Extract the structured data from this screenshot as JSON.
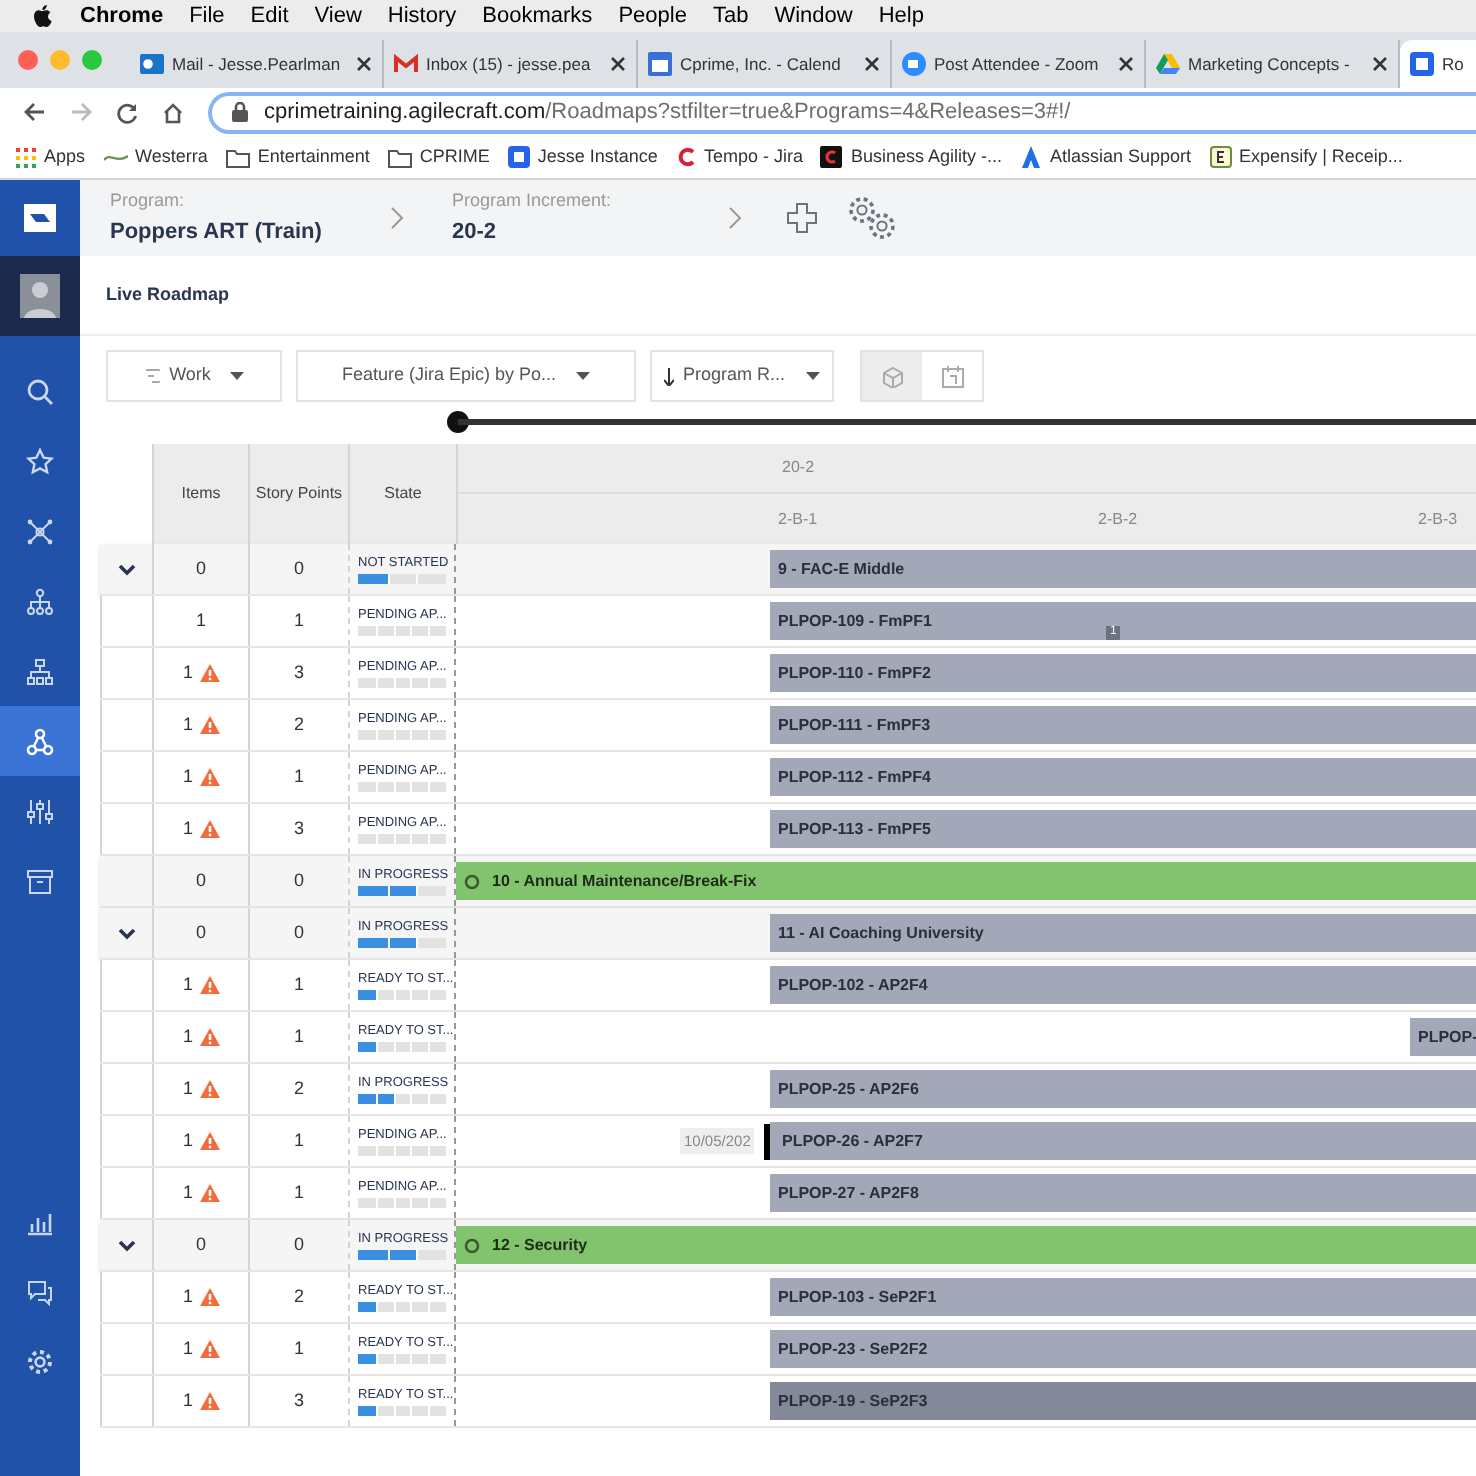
{
  "menu_bar": {
    "app": "Chrome",
    "items": [
      "File",
      "Edit",
      "View",
      "History",
      "Bookmarks",
      "People",
      "Tab",
      "Window",
      "Help"
    ]
  },
  "tabs": [
    {
      "label": "Mail - Jesse.Pearlman",
      "kind": "mail",
      "selected": false
    },
    {
      "label": "Inbox (15) - jesse.pea",
      "kind": "gmail",
      "selected": false
    },
    {
      "label": "Cprime, Inc. - Calend",
      "kind": "calendar",
      "selected": false
    },
    {
      "label": "Post Attendee - Zoom",
      "kind": "video",
      "selected": false
    },
    {
      "label": "Marketing Concepts -",
      "kind": "drive",
      "selected": false
    },
    {
      "label": "Ro",
      "kind": "app",
      "selected": true
    }
  ],
  "address_bar": {
    "domain": "cprimetraining.agilecraft.com",
    "path": "/Roadmaps?stfilter=true&Programs=4&Releases=3#!/"
  },
  "bookmarks": [
    {
      "label": "Apps",
      "kind": "apps"
    },
    {
      "label": "Westerra",
      "kind": "wave"
    },
    {
      "label": "Entertainment",
      "kind": "folder"
    },
    {
      "label": "CPRIME",
      "kind": "folder"
    },
    {
      "label": "Jesse Instance",
      "kind": "app"
    },
    {
      "label": "Tempo - Jira",
      "kind": "letter-c"
    },
    {
      "label": "Business Agility -...",
      "kind": "dark-c"
    },
    {
      "label": "Atlassian Support",
      "kind": "atlassian"
    },
    {
      "label": "Expensify | Receip...",
      "kind": "e-badge"
    }
  ],
  "sidebar": {
    "items": [
      {
        "kind": "search",
        "selected": false
      },
      {
        "kind": "star",
        "selected": false
      },
      {
        "kind": "network",
        "selected": false
      },
      {
        "kind": "hierarchy",
        "selected": false
      },
      {
        "kind": "sitemap",
        "selected": false
      },
      {
        "kind": "share",
        "selected": true
      },
      {
        "kind": "sliders",
        "selected": false
      },
      {
        "kind": "archive",
        "selected": false
      }
    ],
    "bottom_items": [
      {
        "kind": "chart",
        "selected": false
      },
      {
        "kind": "chat",
        "selected": false
      },
      {
        "kind": "settings",
        "selected": false
      }
    ]
  },
  "header": {
    "program_label": "Program:",
    "program": "Poppers ART (Train)",
    "increment_label": "Program Increment:",
    "increment": "20-2"
  },
  "page_title": "Live Roadmap",
  "toolbar": {
    "work": "Work",
    "grouping": "Feature (Jira Epic) by Po...",
    "sort": "Program R...",
    "views": [
      {
        "kind": "cube",
        "selected": true
      },
      {
        "kind": "calendar",
        "selected": false
      }
    ]
  },
  "table": {
    "columns": [
      "Items",
      "Story Points",
      "State"
    ],
    "increment": "20-2",
    "sprints": [
      "2-B-1",
      "2-B-2",
      "2-B-3"
    ],
    "rows": [
      {
        "kind": "group",
        "toggle": true,
        "items": "0",
        "warning": false,
        "story_points": "0",
        "state": "NOT STARTED",
        "level": 0.33,
        "selected": false,
        "bar": {
          "label": "9 - FAC-E Middle",
          "kind": "feature"
        }
      },
      {
        "kind": "item",
        "toggle": false,
        "items": "1",
        "warning": false,
        "story_points": "1",
        "state": "PENDING AP...",
        "level": 0,
        "selected": false,
        "bar": {
          "label": "PLPOP-109 - FmPF1",
          "kind": "feature"
        },
        "badge": "1"
      },
      {
        "kind": "item",
        "toggle": false,
        "items": "1",
        "warning": true,
        "story_points": "3",
        "state": "PENDING AP...",
        "level": 0,
        "selected": false,
        "bar": {
          "label": "PLPOP-110 - FmPF2",
          "kind": "feature"
        }
      },
      {
        "kind": "item",
        "toggle": false,
        "items": "1",
        "warning": true,
        "story_points": "2",
        "state": "PENDING AP...",
        "level": 0,
        "selected": false,
        "bar": {
          "label": "PLPOP-111 - FmPF3",
          "kind": "feature"
        }
      },
      {
        "kind": "item",
        "toggle": false,
        "items": "1",
        "warning": true,
        "story_points": "1",
        "state": "PENDING AP...",
        "level": 0,
        "selected": false,
        "bar": {
          "label": "PLPOP-112 - FmPF4",
          "kind": "feature"
        }
      },
      {
        "kind": "item",
        "toggle": false,
        "items": "1",
        "warning": true,
        "story_points": "3",
        "state": "PENDING AP...",
        "level": 0,
        "selected": false,
        "bar": {
          "label": "PLPOP-113 - FmPF5",
          "kind": "feature"
        }
      },
      {
        "kind": "group",
        "toggle": false,
        "items": "0",
        "warning": false,
        "story_points": "0",
        "state": "IN PROGRESS",
        "level": 0.67,
        "selected": false,
        "bar": {
          "label": "10 - Annual Maintenance/Break-Fix",
          "kind": "epic"
        }
      },
      {
        "kind": "group",
        "toggle": true,
        "items": "0",
        "warning": false,
        "story_points": "0",
        "state": "IN PROGRESS",
        "level": 0.67,
        "selected": false,
        "bar": {
          "label": "11 - AI Coaching University",
          "kind": "feature"
        }
      },
      {
        "kind": "item",
        "toggle": false,
        "items": "1",
        "warning": true,
        "story_points": "1",
        "state": "READY TO ST...",
        "level": 0.2,
        "selected": false,
        "bar": {
          "label": "PLPOP-102 - AP2F4",
          "kind": "feature"
        }
      },
      {
        "kind": "item",
        "toggle": false,
        "items": "1",
        "warning": true,
        "story_points": "1",
        "state": "READY TO ST...",
        "level": 0.2,
        "selected": false,
        "bar": {
          "label": "PLPOP-",
          "kind": "late"
        }
      },
      {
        "kind": "item",
        "toggle": false,
        "items": "1",
        "warning": true,
        "story_points": "2",
        "state": "IN PROGRESS",
        "level": 0.4,
        "selected": false,
        "bar": {
          "label": "PLPOP-25 - AP2F6",
          "kind": "feature"
        }
      },
      {
        "kind": "item",
        "toggle": false,
        "items": "1",
        "warning": true,
        "story_points": "1",
        "state": "PENDING AP...",
        "level": 0,
        "selected": false,
        "bar": {
          "label": "PLPOP-26 - AP2F7",
          "kind": "feature"
        },
        "date_tag": "10/05/202"
      },
      {
        "kind": "item",
        "toggle": false,
        "items": "1",
        "warning": true,
        "story_points": "1",
        "state": "PENDING AP...",
        "level": 0,
        "selected": false,
        "bar": {
          "label": "PLPOP-27 - AP2F8",
          "kind": "feature"
        }
      },
      {
        "kind": "group",
        "toggle": true,
        "items": "0",
        "warning": false,
        "story_points": "0",
        "state": "IN PROGRESS",
        "level": 0.67,
        "selected": false,
        "bar": {
          "label": "12 - Security",
          "kind": "epic"
        }
      },
      {
        "kind": "item",
        "toggle": false,
        "items": "1",
        "warning": true,
        "story_points": "2",
        "state": "READY TO ST...",
        "level": 0.2,
        "selected": false,
        "bar": {
          "label": "PLPOP-103 - SeP2F1",
          "kind": "feature"
        }
      },
      {
        "kind": "item",
        "toggle": false,
        "items": "1",
        "warning": true,
        "story_points": "1",
        "state": "READY TO ST...",
        "level": 0.2,
        "selected": false,
        "bar": {
          "label": "PLPOP-23 - SeP2F2",
          "kind": "feature"
        }
      },
      {
        "kind": "item",
        "toggle": false,
        "items": "1",
        "warning": true,
        "story_points": "3",
        "state": "READY TO ST...",
        "level": 0.2,
        "selected": true,
        "bar": {
          "label": "PLPOP-19 - SeP2F3",
          "kind": "feature"
        }
      }
    ]
  }
}
